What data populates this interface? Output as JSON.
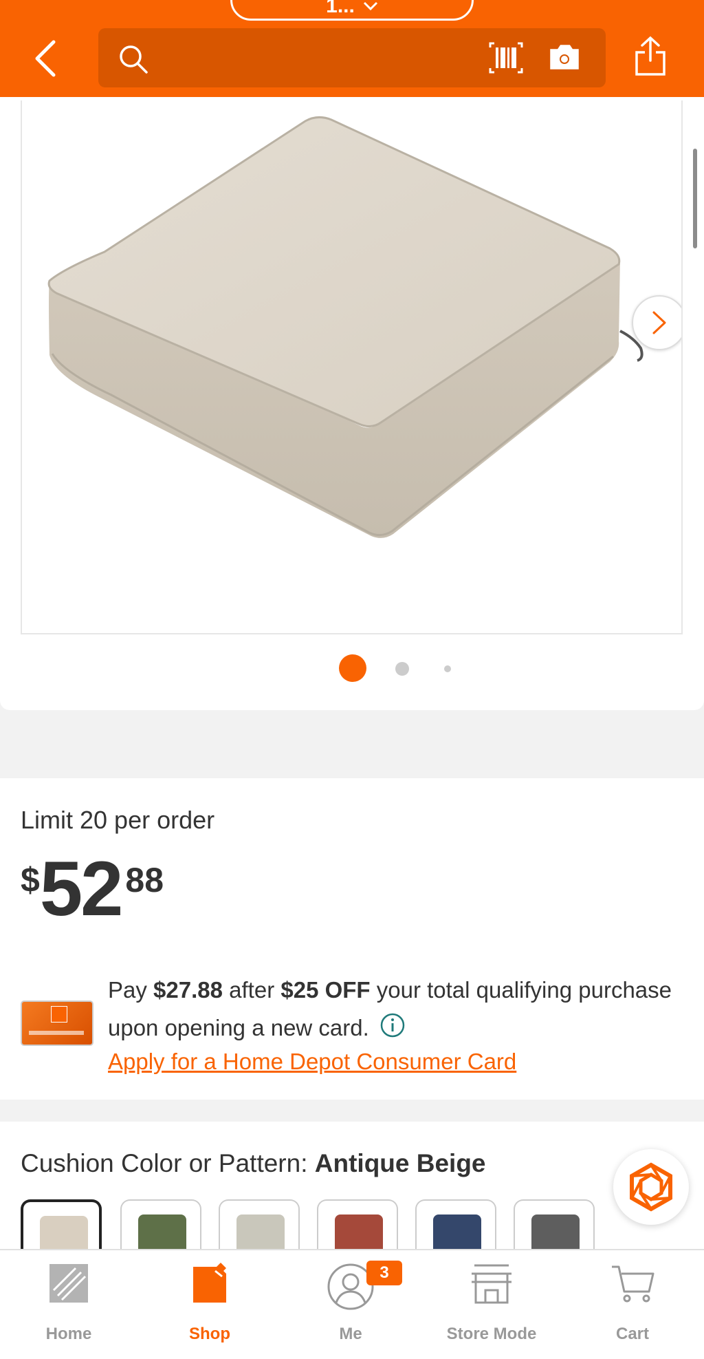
{
  "header": {
    "store_name": "1...",
    "search_placeholder": "",
    "icons": [
      "back-arrow-icon",
      "search-icon",
      "barcode-icon",
      "camera-icon",
      "share-icon"
    ]
  },
  "gallery": {
    "image_count": 3,
    "active_index": 1
  },
  "pricing": {
    "limit_text": "Limit 20 per order",
    "currency": "$",
    "dollars": "52",
    "cents": "88",
    "promo_pay": "Pay ",
    "promo_amount": "$27.88",
    "promo_after": " after ",
    "promo_off": "$25 OFF",
    "promo_rest": " your total qualifying purchase upon opening a new card.",
    "apply_link": "Apply for a Home Depot Consumer Card"
  },
  "color": {
    "label": "Cushion Color or Pattern: ",
    "selected": "Antique Beige",
    "swatches": [
      "#d9cfc0",
      "#5e7048",
      "#c9c7bb",
      "#a5493a",
      "#34476b",
      "#5e5e5e"
    ]
  },
  "nav": {
    "home": "Home",
    "shop": "Shop",
    "me": "Me",
    "me_badge": "3",
    "store_mode": "Store Mode",
    "cart": "Cart"
  },
  "colors": {
    "brand_orange": "#f96302",
    "search_bg": "#d85600"
  }
}
